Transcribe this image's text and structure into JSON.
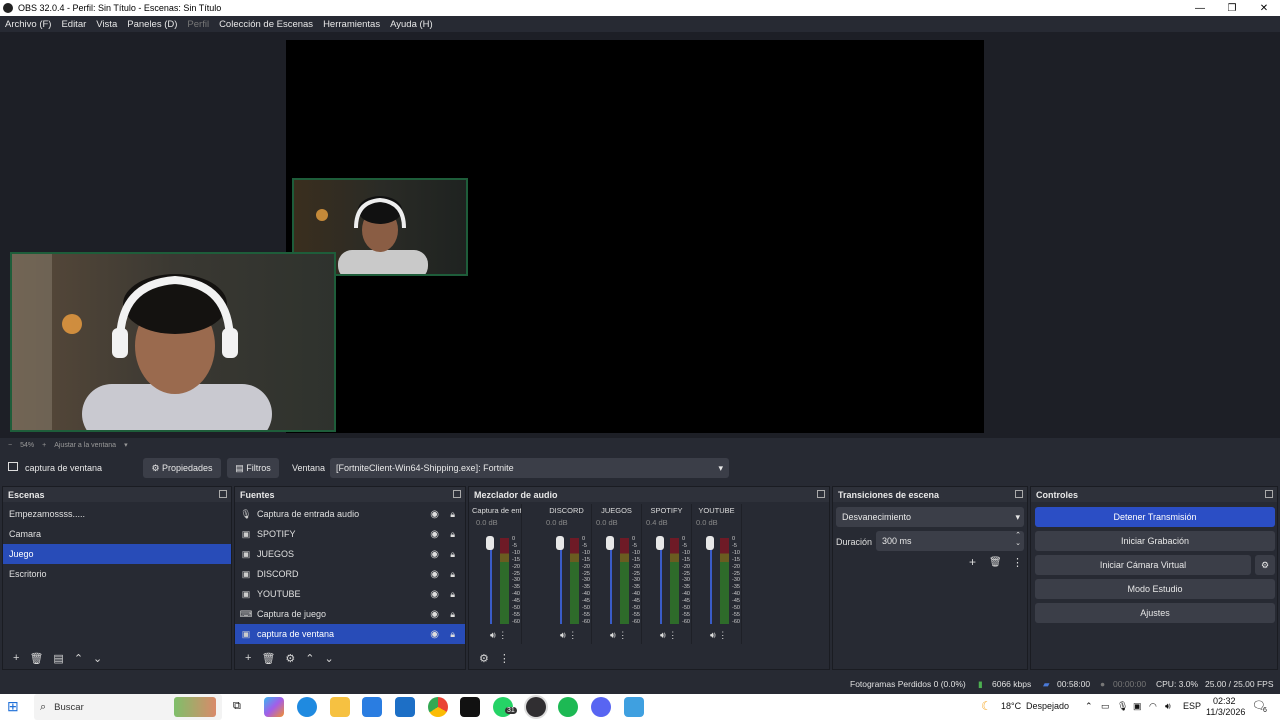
{
  "window": {
    "title": "OBS 32.0.4 - Perfil: Sin Título - Escenas: Sin Título"
  },
  "menu": [
    "Archivo (F)",
    "Editar",
    "Vista",
    "Paneles (D)",
    "Perfil",
    "Colección de Escenas",
    "Herramientas",
    "Ayuda (H)"
  ],
  "zoom": {
    "minus": "−",
    "value": "54%",
    "plus": "+",
    "fit": "Ajustar a la ventana"
  },
  "sourcebar": {
    "name": "captura de ventana",
    "properties": "Propiedades",
    "filters": "Filtros",
    "window_label": "Ventana",
    "window_value": "[FortniteClient-Win64-Shipping.exe]: Fortnite"
  },
  "scenes": {
    "title": "Escenas",
    "items": [
      "Empezamossss.....",
      "Camara",
      "Juego",
      "Escritorio"
    ],
    "selected": "Juego"
  },
  "sources": {
    "title": "Fuentes",
    "items": [
      "Captura de entrada audio",
      "SPOTIFY",
      "JUEGOS",
      "DISCORD",
      "YOUTUBE",
      "Captura de juego",
      "captura de ventana"
    ],
    "selected": "captura de ventana"
  },
  "mixer": {
    "title": "Mezclador de audio",
    "scale": [
      "0",
      "-5",
      "-10",
      "-15",
      "-20",
      "-25",
      "-30",
      "-35",
      "-40",
      "-45",
      "-50",
      "-55",
      "-60"
    ],
    "channels": [
      {
        "name": "Captura de entrada audio",
        "db": "0.0 dB"
      },
      {
        "name": "DISCORD",
        "db": "0.0 dB"
      },
      {
        "name": "JUEGOS",
        "db": "0.0 dB"
      },
      {
        "name": "SPOTIFY",
        "db": "0.4 dB"
      },
      {
        "name": "YOUTUBE",
        "db": "0.0 dB"
      }
    ]
  },
  "transitions": {
    "title": "Transiciones de escena",
    "type": "Desvanecimiento",
    "duration_label": "Duración",
    "duration_value": "300 ms"
  },
  "controls": {
    "title": "Controles",
    "stop_stream": "Detener Transmisión",
    "start_record": "Iniciar Grabación",
    "virtual_cam": "Iniciar Cámara Virtual",
    "studio_mode": "Modo Estudio",
    "settings": "Ajustes"
  },
  "status": {
    "dropped": "Fotogramas Perdidos 0 (0.0%)",
    "bitrate": "6066 kbps",
    "stream_time": "00:58:00",
    "rec_time": "00:00:00",
    "cpu": "CPU: 3.0%",
    "fps": "25.00 / 25.00 FPS"
  },
  "taskbar": {
    "search": "Buscar",
    "weather": "18°C",
    "weather_text": "Despejado",
    "lang": "ESP",
    "time": "02:32",
    "date": "11/3/2026",
    "notif_count": "6",
    "whatsapp_badge": "31"
  },
  "colors": {
    "accent": "#284cb8",
    "panel": "#272a33",
    "button": "#3b3e48"
  }
}
